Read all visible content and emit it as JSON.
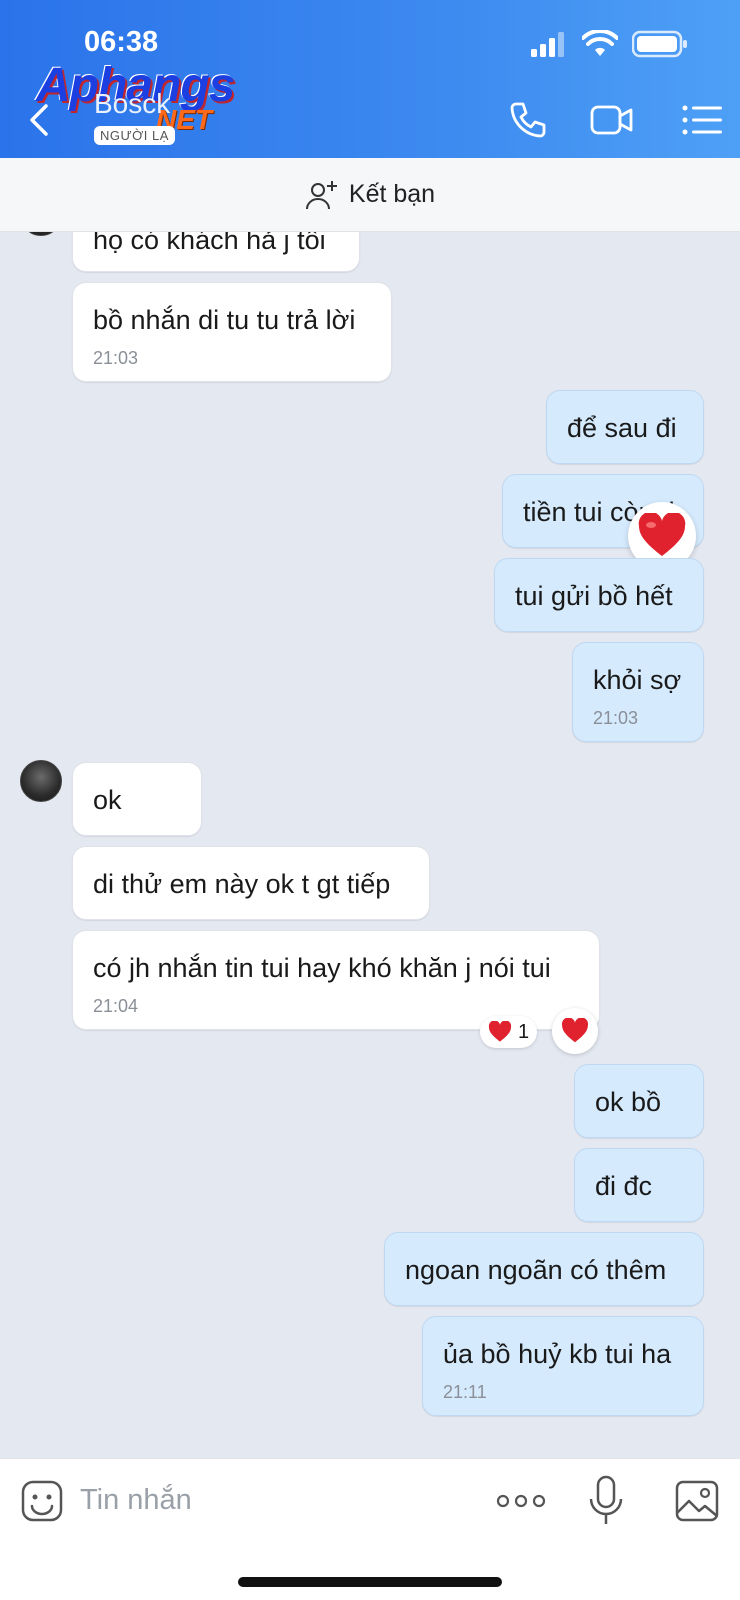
{
  "status": {
    "time": "06:38"
  },
  "header": {
    "contact_name": "Bosck",
    "stranger_badge": "NGƯỜI LẠ",
    "logo_main": "Aphangs",
    "logo_net": "NET",
    "icons": [
      "back-icon",
      "phone-icon",
      "video-icon",
      "list-menu-icon"
    ],
    "gradient": [
      "#2a73ea",
      "#4ea0f6"
    ]
  },
  "friend_bar": {
    "label": "Kết bạn",
    "icon": "add-friend-icon"
  },
  "messages": [
    {
      "side": "in",
      "text": "họ có khách hả j tôi"
    },
    {
      "side": "in",
      "text": "bồ nhắn di tu tu trả lời",
      "time": "21:03"
    },
    {
      "side": "out",
      "text": "để sau đi"
    },
    {
      "side": "out",
      "text": "tiền tui còn ti",
      "reaction": "heart"
    },
    {
      "side": "out",
      "text": "tui gửi bồ hết"
    },
    {
      "side": "out",
      "text": "khỏi sợ",
      "time": "21:03"
    },
    {
      "side": "in",
      "text": "ok"
    },
    {
      "side": "in",
      "text": "di thử em này ok t gt tiếp"
    },
    {
      "side": "in",
      "text": "có jh nhắn tin tui hay khó khăn j nói tui",
      "time": "21:04",
      "reaction_count": "1"
    },
    {
      "side": "out",
      "text": "ok bồ"
    },
    {
      "side": "out",
      "text": "đi đc"
    },
    {
      "side": "out",
      "text": "ngoan ngoãn có thêm"
    },
    {
      "side": "out",
      "text": "ủa bồ huỷ kb tui ha",
      "time": "21:11"
    }
  ],
  "composer": {
    "placeholder": "Tin nhắn",
    "icons": [
      "emoji-icon",
      "more-dots-icon",
      "microphone-icon",
      "image-icon"
    ]
  },
  "colors": {
    "incoming": "#ffffff",
    "outgoing": "#d5eafd",
    "background": "#e4e8f1",
    "heart": "#e0222e"
  }
}
